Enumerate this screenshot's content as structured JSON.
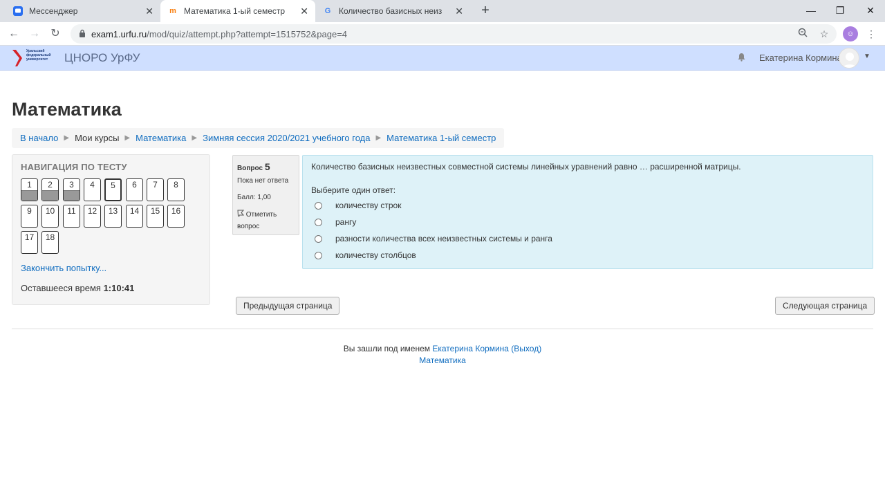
{
  "browser": {
    "tabs": [
      {
        "title": "Мессенджер"
      },
      {
        "title": "Математика 1-ый семестр"
      },
      {
        "title": "Количество базисных неизвест"
      }
    ],
    "url_host": "exam1.urfu.ru",
    "url_path": "/mod/quiz/attempt.php?attempt=1515752&page=4"
  },
  "header": {
    "logo_lines": [
      "Уральский",
      "федеральный",
      "университет"
    ],
    "site_name": "ЦНОРО УрФУ",
    "user_name": "Екатерина Кормина"
  },
  "page": {
    "title": "Математика",
    "breadcrumb": [
      {
        "label": "В начало",
        "link": true
      },
      {
        "label": "Мои курсы",
        "link": false
      },
      {
        "label": "Математика",
        "link": true
      },
      {
        "label": "Зимняя сессия 2020/2021 учебного года",
        "link": true
      },
      {
        "label": "Математика 1-ый семестр",
        "link": true
      }
    ]
  },
  "quiz_nav": {
    "heading": "НАВИГАЦИЯ ПО ТЕСТУ",
    "questions": [
      {
        "n": "1",
        "state": "answered"
      },
      {
        "n": "2",
        "state": "answered"
      },
      {
        "n": "3",
        "state": "answered"
      },
      {
        "n": "4",
        "state": "notyet"
      },
      {
        "n": "5",
        "state": "current"
      },
      {
        "n": "6",
        "state": "notyet"
      },
      {
        "n": "7",
        "state": "notyet"
      },
      {
        "n": "8",
        "state": "notyet"
      },
      {
        "n": "9",
        "state": "notyet"
      },
      {
        "n": "10",
        "state": "notyet"
      },
      {
        "n": "11",
        "state": "notyet"
      },
      {
        "n": "12",
        "state": "notyet"
      },
      {
        "n": "13",
        "state": "notyet"
      },
      {
        "n": "14",
        "state": "notyet"
      },
      {
        "n": "15",
        "state": "notyet"
      },
      {
        "n": "16",
        "state": "notyet"
      },
      {
        "n": "17",
        "state": "notyet"
      },
      {
        "n": "18",
        "state": "notyet"
      }
    ],
    "finish_label": "Закончить попытку...",
    "time_label": "Оставшееся время",
    "time_value": "1:10:41"
  },
  "question": {
    "label": "Вопрос",
    "number": "5",
    "state": "Пока нет ответа",
    "grade": "Балл: 1,00",
    "flag_label": "Отметить вопрос",
    "text": "Количество базисных неизвестных совместной системы линейных уравнений равно … расширенной матрицы.",
    "prompt": "Выберите один ответ:",
    "options": [
      "количеству строк",
      "рангу",
      "разности количества всех неизвестных системы и ранга",
      "количеству столбцов"
    ]
  },
  "buttons": {
    "prev": "Предыдущая страница",
    "next": "Следующая страница"
  },
  "footer": {
    "logged_in_as": "Вы зашли под именем",
    "user_link": "Екатерина Кормина",
    "logout_link": "(Выход)",
    "course_link": "Математика"
  },
  "colors": {
    "header_bg": "#cfdfff",
    "link": "#0f6cbf",
    "question_bg": "#def2f8"
  }
}
